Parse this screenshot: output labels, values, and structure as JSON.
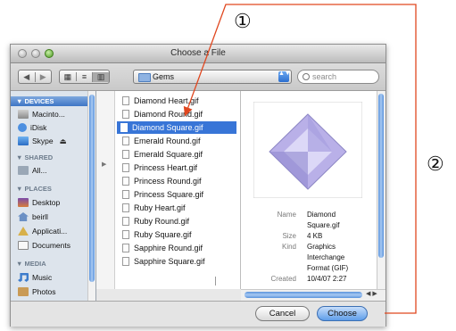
{
  "callouts": [
    "①",
    "②"
  ],
  "window": {
    "title": "Choose a File",
    "traffic_lights": [
      "close",
      "minimize",
      "zoom"
    ]
  },
  "toolbar": {
    "back_icon": "◀",
    "forward_icon": "▶",
    "view_icons": [
      "▦",
      "≡",
      "▥"
    ],
    "location": "Gems",
    "location_arrows": "▲▼",
    "search_placeholder": "search"
  },
  "sidebar": {
    "sections": [
      {
        "title": "▼ DEVICES",
        "items": [
          {
            "label": "Macinto...",
            "icon": "hard-disk-icon"
          },
          {
            "label": "iDisk",
            "icon": "idisk-icon"
          },
          {
            "label": "Skype",
            "icon": "skype-disk-icon",
            "eject": "⏏"
          }
        ]
      },
      {
        "title": "▼ SHARED",
        "items": [
          {
            "label": "All...",
            "icon": "network-icon"
          }
        ]
      },
      {
        "title": "▼ PLACES",
        "items": [
          {
            "label": "Desktop",
            "icon": "desktop-icon"
          },
          {
            "label": "beirll",
            "icon": "home-icon"
          },
          {
            "label": "Applicati...",
            "icon": "applications-icon"
          },
          {
            "label": "Documents",
            "icon": "documents-icon"
          }
        ]
      },
      {
        "title": "▼ MEDIA",
        "items": [
          {
            "label": "Music",
            "icon": "music-icon"
          },
          {
            "label": "Photos",
            "icon": "photos-icon"
          }
        ]
      }
    ]
  },
  "files": [
    {
      "name": "Diamond Heart.gif"
    },
    {
      "name": "Diamond Round.gif"
    },
    {
      "name": "Diamond Square.gif",
      "selected": true
    },
    {
      "name": "Emerald Round.gif"
    },
    {
      "name": "Emerald Square.gif"
    },
    {
      "name": "Princess Heart.gif"
    },
    {
      "name": "Princess Round.gif"
    },
    {
      "name": "Princess Square.gif"
    },
    {
      "name": "Ruby Heart.gif"
    },
    {
      "name": "Ruby Round.gif"
    },
    {
      "name": "Ruby Square.gif"
    },
    {
      "name": "Sapphire Round.gif"
    },
    {
      "name": "Sapphire Square.gif"
    }
  ],
  "preview": {
    "name_label": "Name",
    "name_value_1": "Diamond",
    "name_value_2": "Square.gif",
    "size_label": "Size",
    "size_value": "4 KB",
    "kind_label": "Kind",
    "kind_value_1": "Graphics",
    "kind_value_2": "Interchange",
    "kind_value_3": "Format (GIF)",
    "created_label": "Created",
    "created_value": "10/4/07 2:27"
  },
  "buttons": {
    "cancel": "Cancel",
    "choose": "Choose"
  },
  "colors": {
    "selection": "#3875d7",
    "annotation": "#e0471f",
    "choose_button": "#5e9ee9"
  }
}
